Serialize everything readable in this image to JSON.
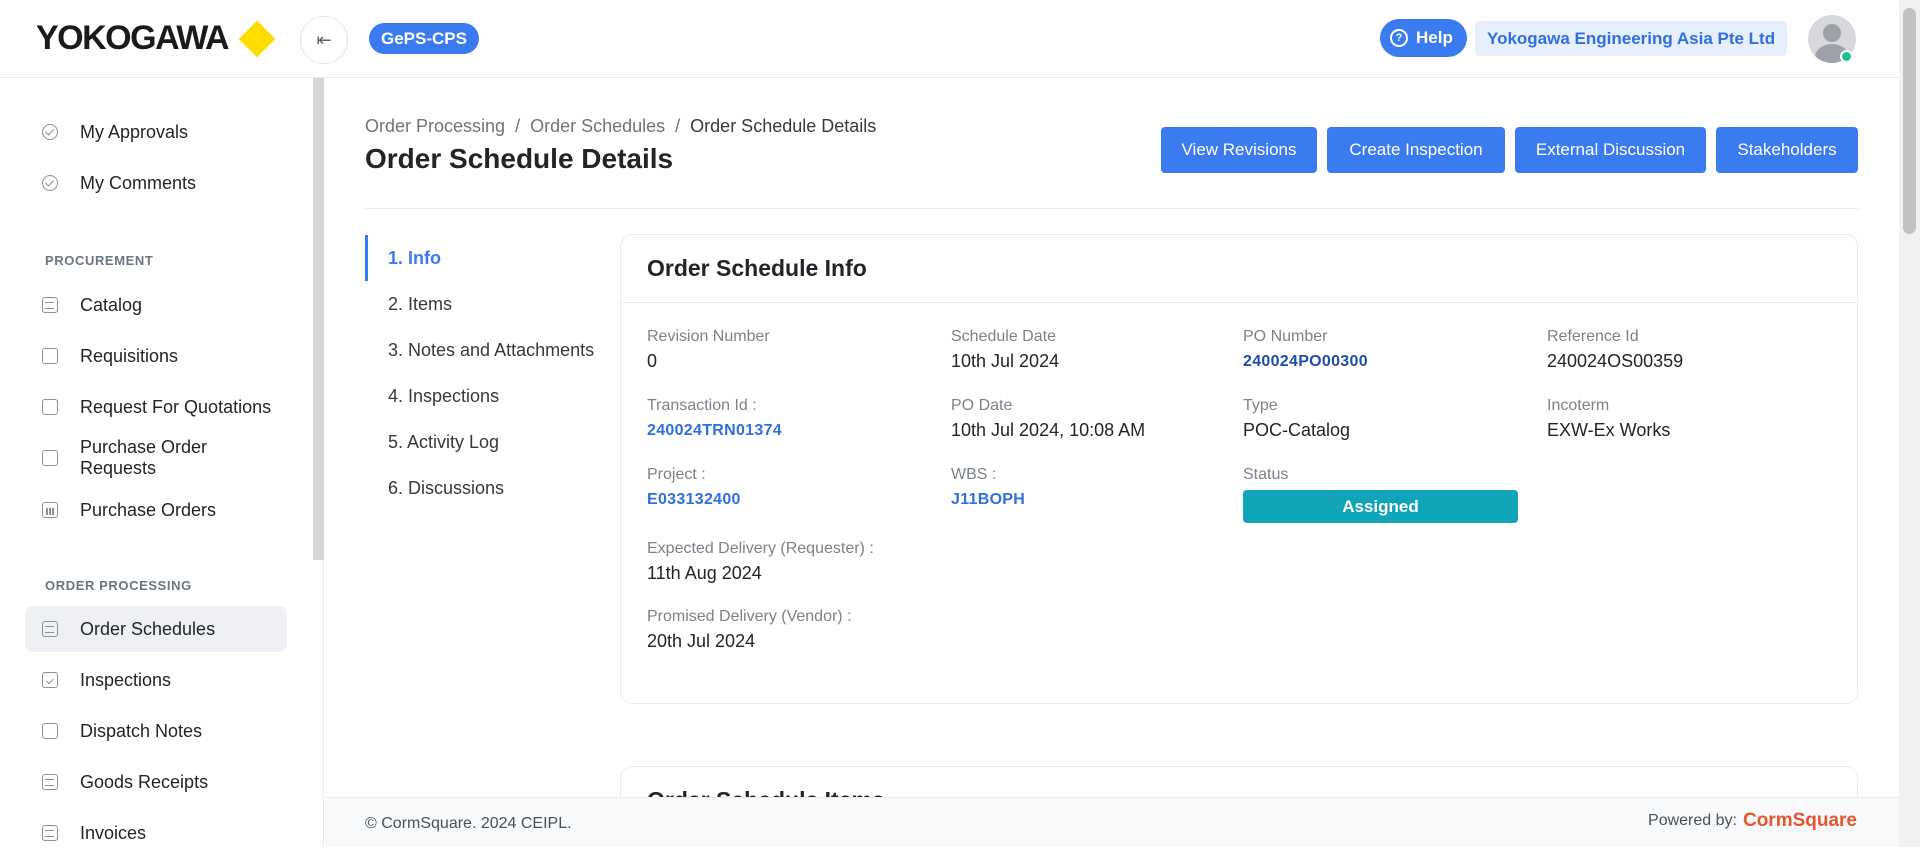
{
  "header": {
    "logo_text": "YOKOGAWA",
    "collapse_icon": "collapse-left-icon",
    "app_badge": "GePS-CPS",
    "help_label": "Help",
    "help_icon": "question-circle-icon",
    "company": "Yokogawa Engineering Asia Pte Ltd",
    "avatar_icon": "user-avatar-icon",
    "online_status_color": "#1fbf8f"
  },
  "sidebar": {
    "top_items": [
      {
        "label": "My Approvals",
        "icon": "check-circle-icon"
      },
      {
        "label": "My Comments",
        "icon": "check-circle-icon"
      }
    ],
    "procurement_label": "PROCUREMENT",
    "procurement_items": [
      {
        "label": "Catalog",
        "icon": "catalog-icon"
      },
      {
        "label": "Requisitions",
        "icon": "document-icon"
      },
      {
        "label": "Request For Quotations",
        "icon": "document-icon"
      },
      {
        "label": "Purchase Order Requests",
        "icon": "document-icon"
      },
      {
        "label": "Purchase Orders",
        "icon": "chart-icon"
      }
    ],
    "order_processing_label": "ORDER PROCESSING",
    "order_items": [
      {
        "label": "Order Schedules",
        "icon": "schedule-icon",
        "active": true
      },
      {
        "label": "Inspections",
        "icon": "checklist-icon"
      },
      {
        "label": "Dispatch Notes",
        "icon": "document-icon"
      },
      {
        "label": "Goods Receipts",
        "icon": "receipt-icon"
      },
      {
        "label": "Invoices",
        "icon": "invoice-icon"
      }
    ]
  },
  "main": {
    "breadcrumb": [
      "Order Processing",
      "Order Schedules",
      "Order Schedule Details"
    ],
    "breadcrumb_separator": "/",
    "title": "Order Schedule Details",
    "actions": [
      "View Revisions",
      "Create Inspection",
      "External Discussion",
      "Stakeholders"
    ],
    "steps": [
      "1. Info",
      "2. Items",
      "3. Notes and Attachments",
      "4. Inspections",
      "5. Activity Log",
      "6. Discussions"
    ],
    "active_step": "1. Info",
    "info_card": {
      "title": "Order Schedule Info",
      "revision_number": {
        "label": "Revision Number",
        "value": "0"
      },
      "schedule_date": {
        "label": "Schedule Date",
        "value": "10th Jul 2024"
      },
      "po_number": {
        "label": "PO Number",
        "value": "240024PO00300"
      },
      "reference_id": {
        "label": "Reference Id",
        "value": "240024OS00359"
      },
      "transaction_id": {
        "label": "Transaction Id :",
        "value": "240024TRN01374"
      },
      "po_date": {
        "label": "PO Date",
        "value": "10th Jul 2024, 10:08 AM"
      },
      "type": {
        "label": "Type",
        "value": "POC-Catalog"
      },
      "incoterm": {
        "label": "Incoterm",
        "value": "EXW-Ex Works"
      },
      "project": {
        "label": "Project :",
        "value": "E033132400"
      },
      "wbs": {
        "label": "WBS :",
        "value": "J11BOPH"
      },
      "status": {
        "label": "Status",
        "value": "Assigned",
        "color": "#0fa4b8"
      },
      "expected_delivery": {
        "label": "Expected Delivery (Requester) :",
        "value": "11th Aug 2024"
      },
      "promised_delivery": {
        "label": "Promised Delivery (Vendor) :",
        "value": "20th Jul 2024"
      }
    },
    "items_card_title": "Order Schedule Items"
  },
  "footer": {
    "copyright": "© CormSquare. 2024 CEIPL.",
    "powered_by": "Powered by:",
    "brand": "CormSquare",
    "brand_color": "#e8542c"
  },
  "colors": {
    "primary": "#3b7bf0",
    "logo_accent": "#ffdc00"
  }
}
